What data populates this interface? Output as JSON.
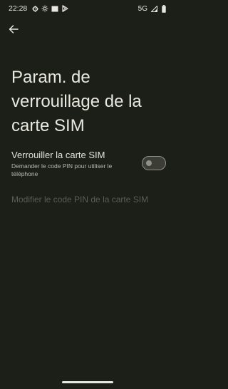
{
  "status_bar": {
    "time": "22:28",
    "left_icons": [
      "gear-icon",
      "brightness-icon",
      "square-icon",
      "play-store-icon"
    ],
    "network": "5G",
    "right_icons": [
      "signal-icon",
      "battery-icon"
    ]
  },
  "app_bar": {
    "back_icon": "arrow-back-icon"
  },
  "page": {
    "title": "Param. de verrouillage de la carte SIM"
  },
  "lock_sim": {
    "title": "Verrouiller la carte SIM",
    "summary": "Demander le code PIN pour utiliser le téléphone",
    "enabled": false
  },
  "change_pin": {
    "label": "Modifier le code PIN de la carte SIM",
    "disabled": true
  },
  "colors": {
    "background": "#1c1e18",
    "text_primary": "#e4e4dc",
    "text_disabled": "#5a5c55",
    "toggle_outline": "#8e9186"
  }
}
